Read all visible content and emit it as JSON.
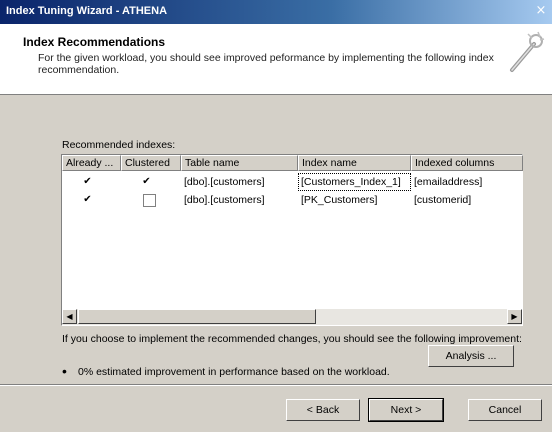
{
  "window": {
    "title": "Index Tuning Wizard - ATHENA",
    "close_glyph": "×"
  },
  "header": {
    "title": "Index Recommendations",
    "description": "For the given workload, you should see improved peformance by implementing the following index recommendation."
  },
  "recommended_label": "Recommended indexes:",
  "table": {
    "columns": [
      "Already ...",
      "Clustered",
      "Table name",
      "Index name",
      "Indexed columns"
    ],
    "rows": [
      {
        "already": true,
        "clustered": true,
        "table": "[dbo].[customers]",
        "index": "[Customers_Index_1]",
        "columns": "[emailaddress]"
      },
      {
        "already": true,
        "clustered": false,
        "table": "[dbo].[customers]",
        "index": "[PK_Customers]",
        "columns": "[customerid]"
      }
    ]
  },
  "improvement_text": "If you choose to implement the recommended changes, you should see the following improvement:",
  "bullet_text": "0% estimated improvement in performance based on the workload.",
  "buttons": {
    "analysis": "Analysis ...",
    "back": "< Back",
    "next": "Next >",
    "cancel": "Cancel"
  },
  "check_glyph": "✔"
}
